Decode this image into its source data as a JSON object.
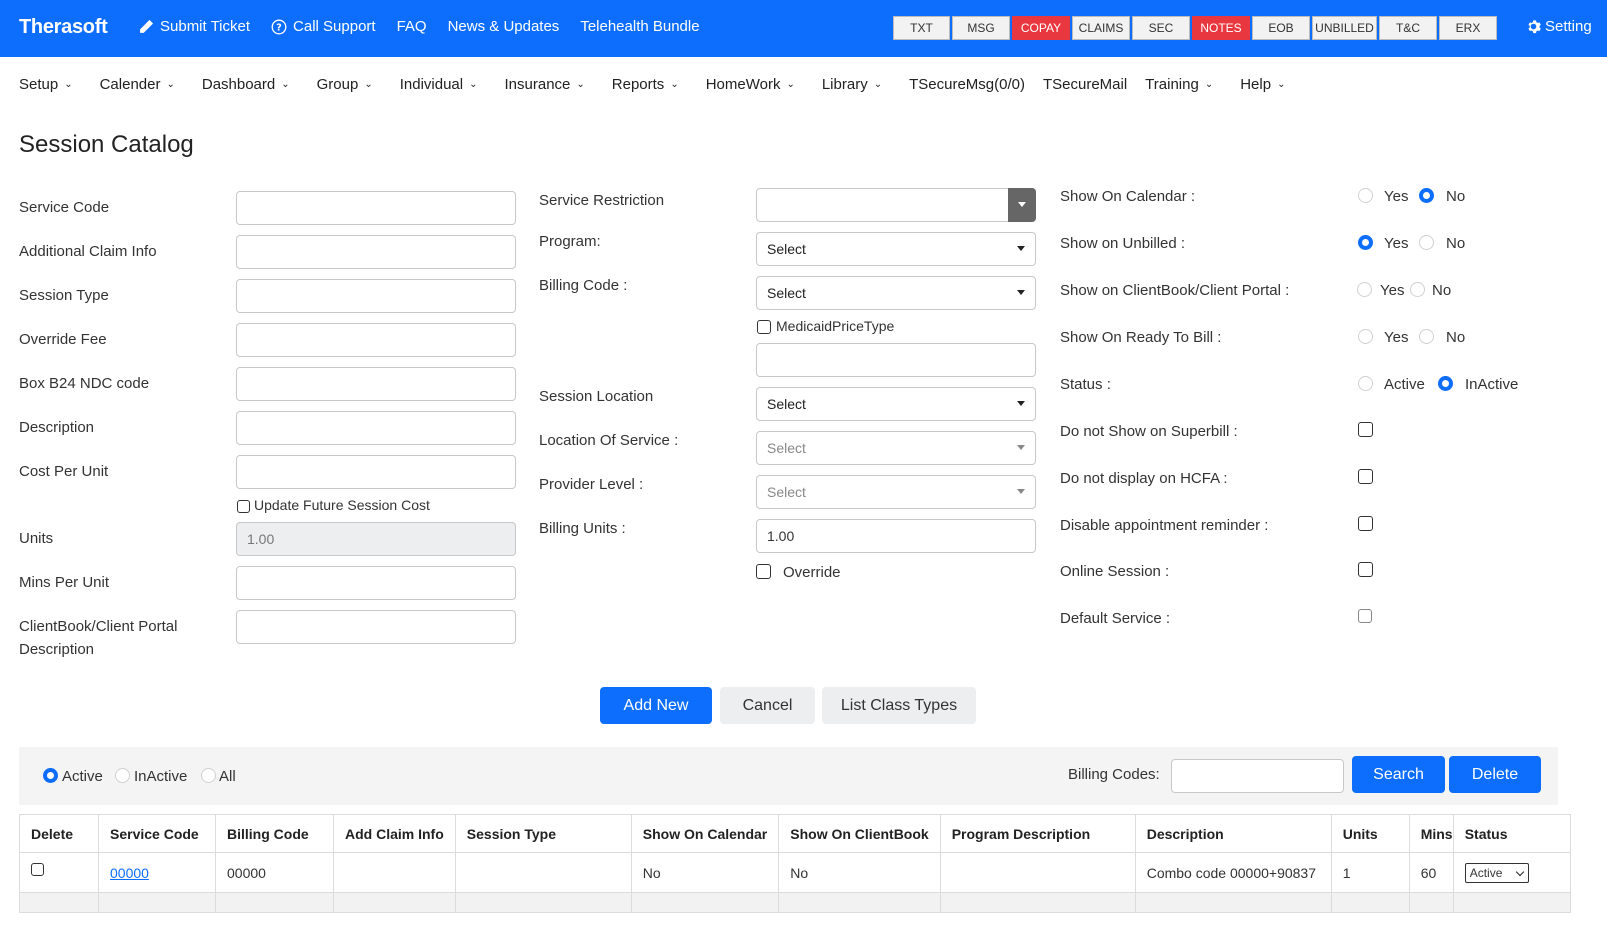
{
  "brand": "Therasoft",
  "toplinks": [
    "Submit Ticket",
    "Call Support",
    "FAQ",
    "News & Updates",
    "Telehealth Bundle"
  ],
  "quick_buttons": [
    {
      "label": "TXT",
      "red": false
    },
    {
      "label": "MSG",
      "red": false
    },
    {
      "label": "COPAY",
      "red": true
    },
    {
      "label": "CLAIMS",
      "red": false
    },
    {
      "label": "SEC",
      "red": false
    },
    {
      "label": "NOTES",
      "red": true
    },
    {
      "label": "EOB",
      "red": false
    },
    {
      "label": "UNBILLED",
      "red": false
    },
    {
      "label": "T&C",
      "red": false
    },
    {
      "label": "ERX",
      "red": false
    }
  ],
  "setting_label": "Setting",
  "nav": [
    "Setup",
    "Calender",
    "Dashboard",
    "Group",
    "Individual",
    "Insurance",
    "Reports",
    "HomeWork",
    "Library",
    "TSecureMsg(0/0)",
    "TSecureMail",
    "Training",
    "Help"
  ],
  "page_title": "Session Catalog",
  "col1": {
    "service_code": "Service Code",
    "additional_claim_info": "Additional Claim Info",
    "session_type": "Session Type",
    "override_fee": "Override Fee",
    "box_b24": "Box B24 NDC code",
    "description": "Description",
    "cost_per_unit": "Cost Per Unit",
    "update_future": "Update Future Session Cost",
    "units": "Units",
    "units_value": "1.00",
    "mins_per_unit": "Mins Per Unit",
    "clientbook_1": "ClientBook/Client Portal",
    "clientbook_2": "Description"
  },
  "col2": {
    "service_restriction": "Service Restriction",
    "program": "Program:",
    "program_value": "Select",
    "billing_code": "Billing Code :",
    "billing_code_value": "Select",
    "medicaid": "MedicaidPriceType",
    "session_location": "Session Location",
    "session_location_value": "Select",
    "location_of_service": "Location Of Service :",
    "location_of_service_value": "Select",
    "provider_level": "Provider Level :",
    "provider_level_value": "Select",
    "billing_units": "Billing Units :",
    "billing_units_value": "1.00",
    "override": "Override"
  },
  "col3": {
    "show_on_calendar": "Show On Calendar :",
    "show_on_unbilled": "Show on Unbilled :",
    "show_on_clientbook": "Show on ClientBook/Client Portal :",
    "show_on_ready": "Show On Ready To Bill :",
    "status": "Status :",
    "yes": "Yes",
    "no": "No",
    "active": "Active",
    "inactive": "InActive",
    "no_superbill": "Do not Show on Superbill :",
    "no_hcfa": "Do not display on HCFA :",
    "disable_reminder": "Disable appointment reminder :",
    "online_session": "Online Session :",
    "default_service": "Default Service :"
  },
  "actions": {
    "add_new": "Add New",
    "cancel": "Cancel",
    "list_class_types": "List Class Types"
  },
  "filter": {
    "active": "Active",
    "inactive": "InActive",
    "all": "All",
    "billing_codes": "Billing Codes:",
    "search": "Search",
    "delete": "Delete"
  },
  "table": {
    "headers": [
      "Delete",
      "Service Code",
      "Billing Code",
      "Add Claim Info",
      "Session Type",
      "Show On Calendar",
      "Show On ClientBook",
      "Program Description",
      "Description",
      "Units",
      "Mins",
      "Status"
    ],
    "rows": [
      {
        "service_code": "00000",
        "billing_code": "00000",
        "add_claim_info": "",
        "session_type": "",
        "show_on_calendar": "No",
        "show_on_clientbook": "No",
        "program_description": "",
        "description": "Combo code 00000+90837",
        "units": "1",
        "mins": "60",
        "status": "Active"
      }
    ]
  },
  "colors": {
    "primary": "#0d6efd",
    "red": "#e8373f"
  }
}
